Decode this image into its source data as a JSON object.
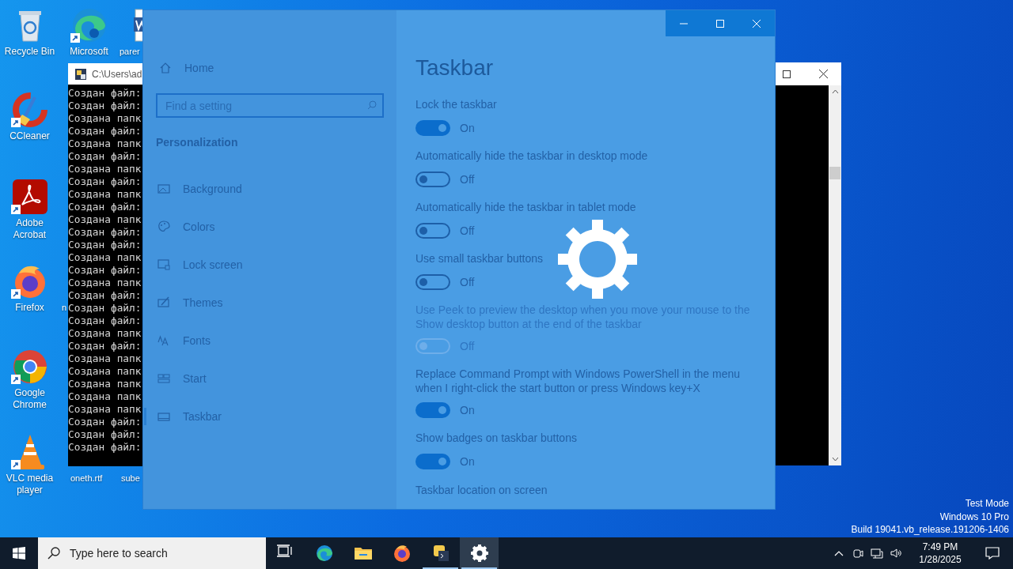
{
  "desktop_icons": [
    {
      "label": "Recycle Bin",
      "kind": "recycle"
    },
    {
      "label": "Microsoft",
      "kind": "edge"
    },
    {
      "label": "parer",
      "kind": "word"
    },
    {
      "label": "CCleaner",
      "kind": "ccleaner"
    },
    {
      "label": "Adobe Acrobat",
      "kind": "acrobat"
    },
    {
      "label": "Firefox",
      "kind": "firefox"
    },
    {
      "label": "n",
      "kind": "label_only"
    },
    {
      "label": "Google Chrome",
      "kind": "chrome"
    },
    {
      "label": "VLC media player",
      "kind": "vlc"
    },
    {
      "label": "oneth.rtf",
      "kind": "label_only"
    },
    {
      "label": "sube",
      "kind": "label_only"
    }
  ],
  "console": {
    "title": "C:\\Users\\ad",
    "lines": [
      "Создан файл:",
      "Создан файл:",
      "Создана папк",
      "Создан файл:",
      "Создана папк",
      "Создан файл:",
      "Создана папк",
      "Создан файл:",
      "Создана папк",
      "Создан файл:",
      "Создана папк",
      "Создан файл:",
      "Создан файл:",
      "Создана папк",
      "Создан файл:",
      "Создана папк",
      "Создан файл:",
      "Создан файл:",
      "Создан файл:",
      "Создана папк",
      "Создан файл:",
      "Создана папк",
      "Создана папк",
      "Создана папк",
      "Создана папк",
      "Создана папк",
      "Создан файл:",
      "Создан файл:",
      "Создан файл:"
    ]
  },
  "settings": {
    "home": "Home",
    "search": {
      "placeholder": "Find a setting"
    },
    "section": "Personalization",
    "nav": [
      {
        "label": "Background",
        "kind": "picture",
        "selected": false
      },
      {
        "label": "Colors",
        "kind": "palette",
        "selected": false
      },
      {
        "label": "Lock screen",
        "kind": "lock",
        "selected": false
      },
      {
        "label": "Themes",
        "kind": "themes",
        "selected": false
      },
      {
        "label": "Fonts",
        "kind": "fonts",
        "selected": false
      },
      {
        "label": "Start",
        "kind": "start",
        "selected": false
      },
      {
        "label": "Taskbar",
        "kind": "taskbar",
        "selected": true
      }
    ],
    "title": "Taskbar",
    "options": [
      {
        "label": "Lock the taskbar",
        "on": true,
        "disabled": false,
        "state": "On"
      },
      {
        "label": "Automatically hide the taskbar in desktop mode",
        "on": false,
        "disabled": false,
        "state": "Off"
      },
      {
        "label": "Automatically hide the taskbar in tablet mode",
        "on": false,
        "disabled": false,
        "state": "Off"
      },
      {
        "label": "Use small taskbar buttons",
        "on": false,
        "disabled": false,
        "state": "Off"
      },
      {
        "label": "Use Peek to preview the desktop when you move your mouse to the Show desktop button at the end of the taskbar",
        "on": false,
        "disabled": true,
        "state": "Off"
      },
      {
        "label": "Replace Command Prompt with Windows PowerShell in the menu when I right-click the start button or press Windows key+X",
        "on": true,
        "disabled": false,
        "state": "On"
      },
      {
        "label": "Show badges on taskbar buttons",
        "on": true,
        "disabled": false,
        "state": "On"
      }
    ],
    "subheading": "Taskbar location on screen"
  },
  "system_info": [
    "Test Mode",
    "Windows 10 Pro",
    "Build 19041.vb_release.191206-1406"
  ],
  "taskbar": {
    "search_placeholder": "Type here to search",
    "apps": [
      {
        "kind": "taskview",
        "running": false,
        "selected": false
      },
      {
        "kind": "edge",
        "running": false,
        "selected": false
      },
      {
        "kind": "folder",
        "running": false,
        "selected": false
      },
      {
        "kind": "firefox",
        "running": false,
        "selected": false
      },
      {
        "kind": "python",
        "running": true,
        "selected": false
      },
      {
        "kind": "settings",
        "running": true,
        "selected": true
      }
    ],
    "time": "7:49 PM",
    "date": "1/28/2025"
  }
}
